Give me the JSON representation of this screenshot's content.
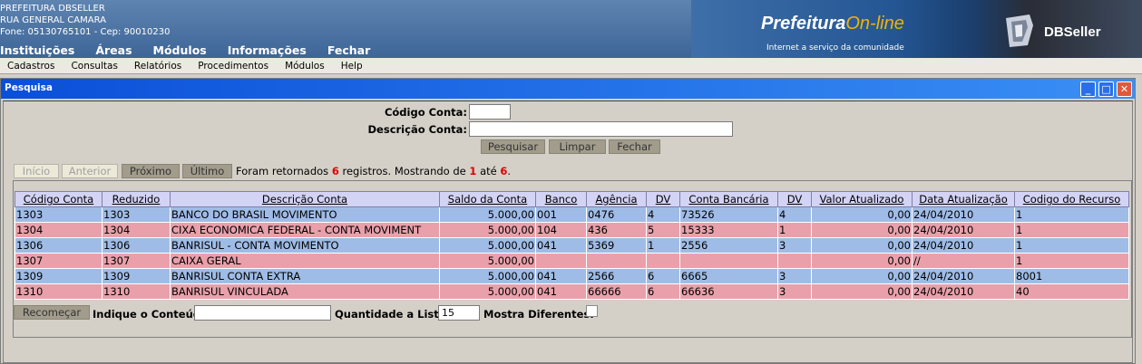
{
  "header": {
    "org_name": "PREFEITURA DBSELLER",
    "address": "RUA GENERAL CAMARA",
    "contact": "Fone: 05130765101  -  Cep: 90010230",
    "menu": [
      "Instituições",
      "Áreas",
      "Módulos",
      "Informações",
      "Fechar"
    ],
    "logo_main": "Prefeitura",
    "logo_online": "On-line",
    "logo_tagline": "Internet a serviço da comunidade",
    "vendor": "DBSeller"
  },
  "submenu": [
    "Cadastros",
    "Consultas",
    "Relatórios",
    "Procedimentos",
    "Módulos",
    "Help"
  ],
  "window": {
    "title": "Pesquisa",
    "minimize": "_",
    "maximize": "□",
    "close": "✕"
  },
  "form": {
    "codigo_label": "Código Conta:",
    "codigo_value": "",
    "descricao_label": "Descrição Conta:",
    "descricao_value": "",
    "pesquisar": "Pesquisar",
    "limpar": "Limpar",
    "fechar": "Fechar"
  },
  "pager": {
    "inicio": "Início",
    "anterior": "Anterior",
    "proximo": "Próximo",
    "ultimo": "Último",
    "text1": "Foram retornados ",
    "total": "6",
    "text2": " registros. Mostrando de ",
    "from": "1",
    "text3": " até ",
    "to": "6",
    "text4": "."
  },
  "table": {
    "headers": [
      "Código Conta",
      "Reduzido",
      "Descrição  Conta",
      "Saldo da Conta",
      "Banco",
      "Agência",
      "DV",
      "Conta Bancária",
      "DV",
      "Valor Atualizado",
      "Data Atualização",
      "Codigo do Recurso"
    ],
    "rows": [
      [
        "1303",
        "1303",
        "BANCO DO BRASIL MOVIMENTO",
        "5.000,00",
        "001",
        "0476",
        "4",
        "73526",
        "4",
        "0,00",
        "24/04/2010",
        "1"
      ],
      [
        "1304",
        "1304",
        "CIXA ECONOMICA FEDERAL - CONTA MOVIMENT",
        "5.000,00",
        "104",
        "436",
        "5",
        "15333",
        "1",
        "0,00",
        "24/04/2010",
        "1"
      ],
      [
        "1306",
        "1306",
        "BANRISUL - CONTA MOVIMENTO",
        "5.000,00",
        "041",
        "5369",
        "1",
        "2556",
        "3",
        "0,00",
        "24/04/2010",
        "1"
      ],
      [
        "1307",
        "1307",
        "CAIXA GERAL",
        "5.000,00",
        "",
        "",
        "",
        "",
        "",
        "0,00",
        "//",
        "1"
      ],
      [
        "1309",
        "1309",
        "BANRISUL CONTA EXTRA",
        "5.000,00",
        "041",
        "2566",
        "6",
        "6665",
        "3",
        "0,00",
        "24/04/2010",
        "8001"
      ],
      [
        "1310",
        "1310",
        "BANRISUL VINCULADA",
        "5.000,00",
        "041",
        "66666",
        "6",
        "66636",
        "3",
        "0,00",
        "24/04/2010",
        "40"
      ]
    ]
  },
  "bottom": {
    "recomecar": "Recomeçar",
    "indique_label": "Indique o Conteúdo:",
    "indique_value": "",
    "quantidade_label": "Quantidade a Listar:",
    "quantidade_value": "15",
    "mostra_label": "Mostra Diferentes:"
  }
}
